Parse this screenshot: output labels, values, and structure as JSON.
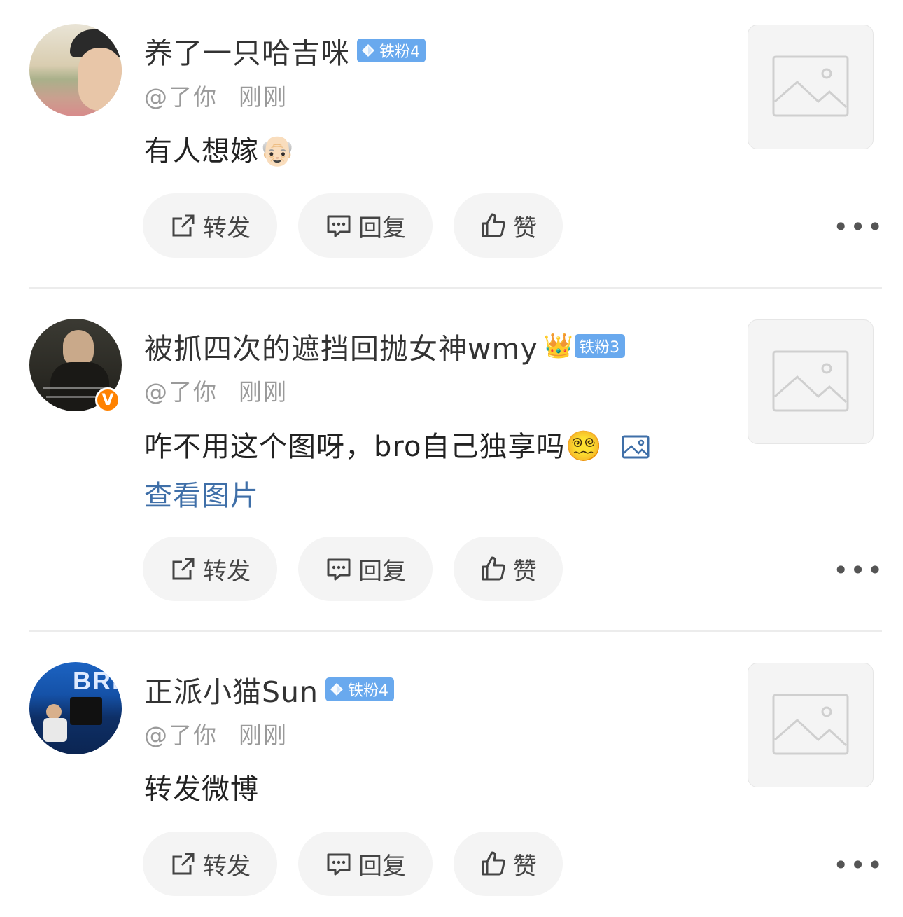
{
  "comments": [
    {
      "username": "养了一只哈吉咪",
      "fan_badge": "铁粉4",
      "mention": "@了你",
      "time": "刚刚",
      "text": "有人想嫁",
      "emoji": "👴🏻",
      "link_text": "",
      "verified_badge": ""
    },
    {
      "username": "被抓四次的遮挡回抛女神wmy",
      "fan_badge": "铁粉3",
      "mention": "@了你",
      "time": "刚刚",
      "text": "咋不用这个图呀，bro自己独享吗",
      "emoji": "😵‍💫",
      "link_text": "查看图片",
      "verified_badge": "V"
    },
    {
      "username": "正派小猫Sun",
      "fan_badge": "铁粉4",
      "mention": "@了你",
      "time": "刚刚",
      "text": "转发微博",
      "emoji": "",
      "link_text": "",
      "verified_badge": ""
    }
  ],
  "actions": {
    "repost_label": "转发",
    "reply_label": "回复",
    "like_label": "赞",
    "more_label": "•••"
  },
  "colors": {
    "fan_badge": "#69a9ee",
    "link": "#3f6fa8",
    "verified": "#ff8200"
  }
}
